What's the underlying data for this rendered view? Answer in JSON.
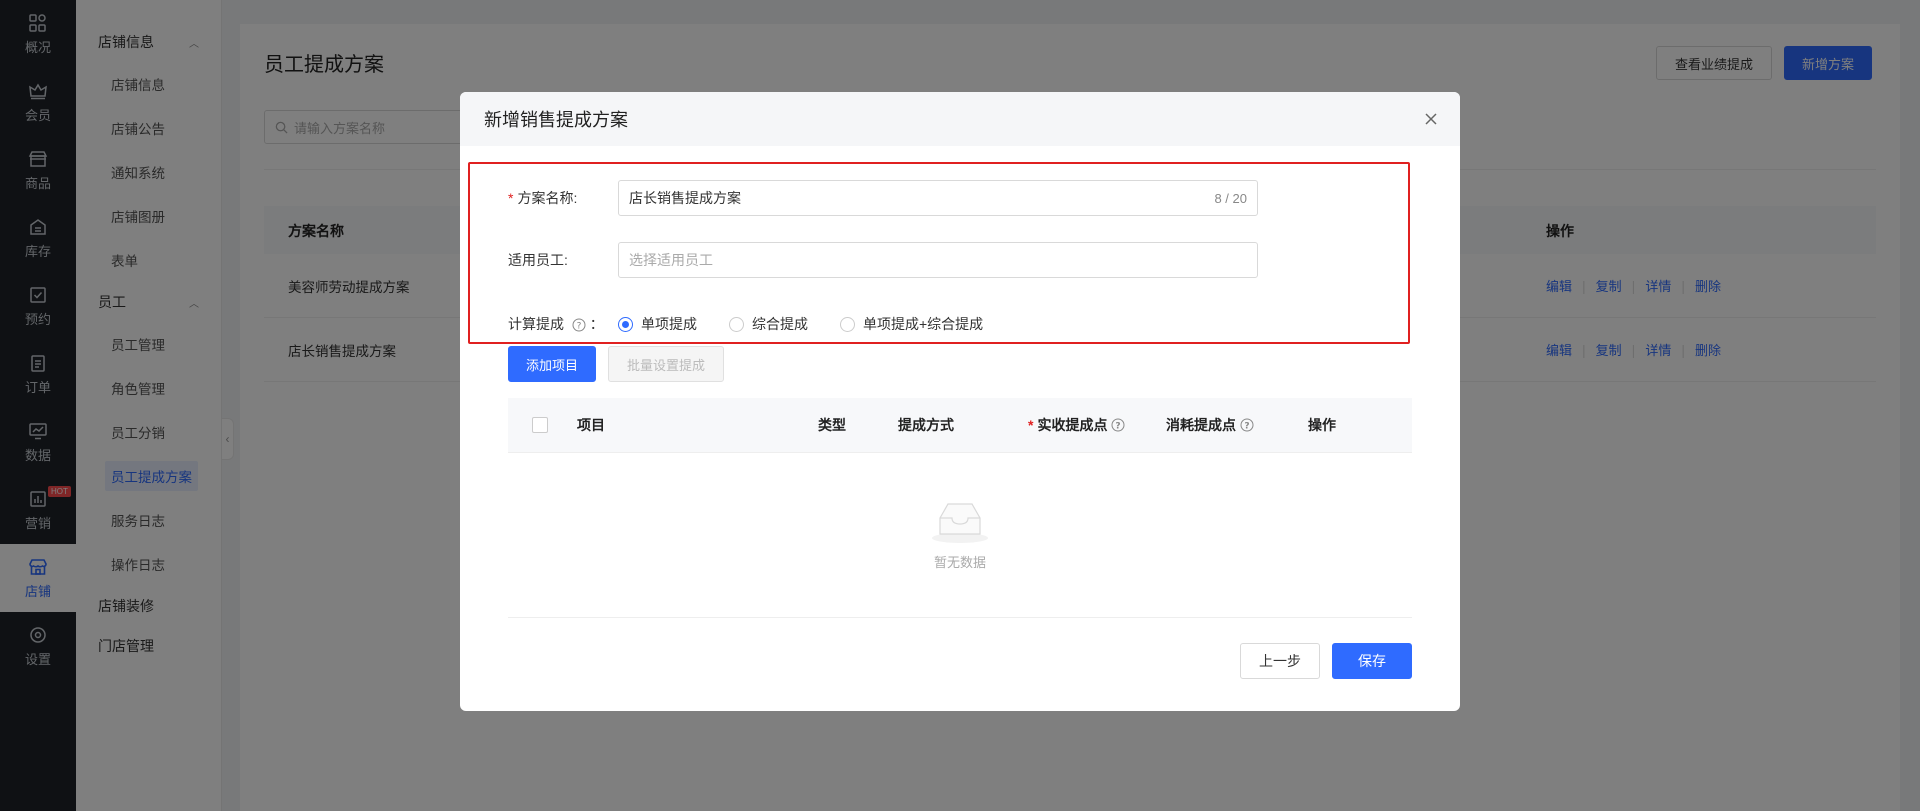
{
  "rail": {
    "items": [
      {
        "label": "概况",
        "icon": "grid-icon"
      },
      {
        "label": "会员",
        "icon": "crown-icon"
      },
      {
        "label": "商品",
        "icon": "shop-icon"
      },
      {
        "label": "库存",
        "icon": "inventory-icon"
      },
      {
        "label": "预约",
        "icon": "calendar-check-icon"
      },
      {
        "label": "订单",
        "icon": "clipboard-icon"
      },
      {
        "label": "数据",
        "icon": "monitor-chart-icon"
      },
      {
        "label": "营销",
        "icon": "bar-chart-icon",
        "badge": "HOT"
      },
      {
        "label": "店铺",
        "icon": "store-icon",
        "active": true
      },
      {
        "label": "设置",
        "icon": "gear-icon"
      }
    ]
  },
  "subnav": {
    "group1": "店铺信息",
    "group1_items": [
      "店铺信息",
      "店铺公告",
      "通知系统",
      "店铺图册",
      "表单"
    ],
    "group2": "员工",
    "group2_items": [
      "员工管理",
      "角色管理",
      "员工分销",
      "员工提成方案",
      "服务日志",
      "操作日志"
    ],
    "group3": "店铺装修",
    "group4": "门店管理"
  },
  "page": {
    "title": "员工提成方案",
    "view_performance_label": "查看业绩提成",
    "new_plan_label": "新增方案",
    "search_placeholder": "请输入方案名称",
    "col_name": "方案名称",
    "col_actions": "操作",
    "rows": [
      {
        "name": "美容师劳动提成方案"
      },
      {
        "name": "店长销售提成方案"
      }
    ],
    "actions": [
      "编辑",
      "复制",
      "详情",
      "删除"
    ]
  },
  "modal": {
    "title": "新增销售提成方案",
    "plan_name_label": "方案名称:",
    "plan_name_value": "店长销售提成方案",
    "plan_name_count": "8 / 20",
    "staff_label": "适用员工:",
    "staff_placeholder": "选择适用员工",
    "calc_label": "计算提成",
    "calc_colon": "：",
    "radio_options": [
      "单项提成",
      "综合提成",
      "单项提成+综合提成"
    ],
    "add_item_label": "添加项目",
    "batch_label": "批量设置提成",
    "columns": {
      "item": "项目",
      "type": "类型",
      "method": "提成方式",
      "actual": "实收提成点",
      "consume": "消耗提成点",
      "ops": "操作"
    },
    "empty_text": "暂无数据",
    "prev_label": "上一步",
    "save_label": "保存"
  },
  "colors": {
    "primary": "#2f6bff",
    "highlight": "#e02020",
    "rail_bg": "#1f2329"
  }
}
